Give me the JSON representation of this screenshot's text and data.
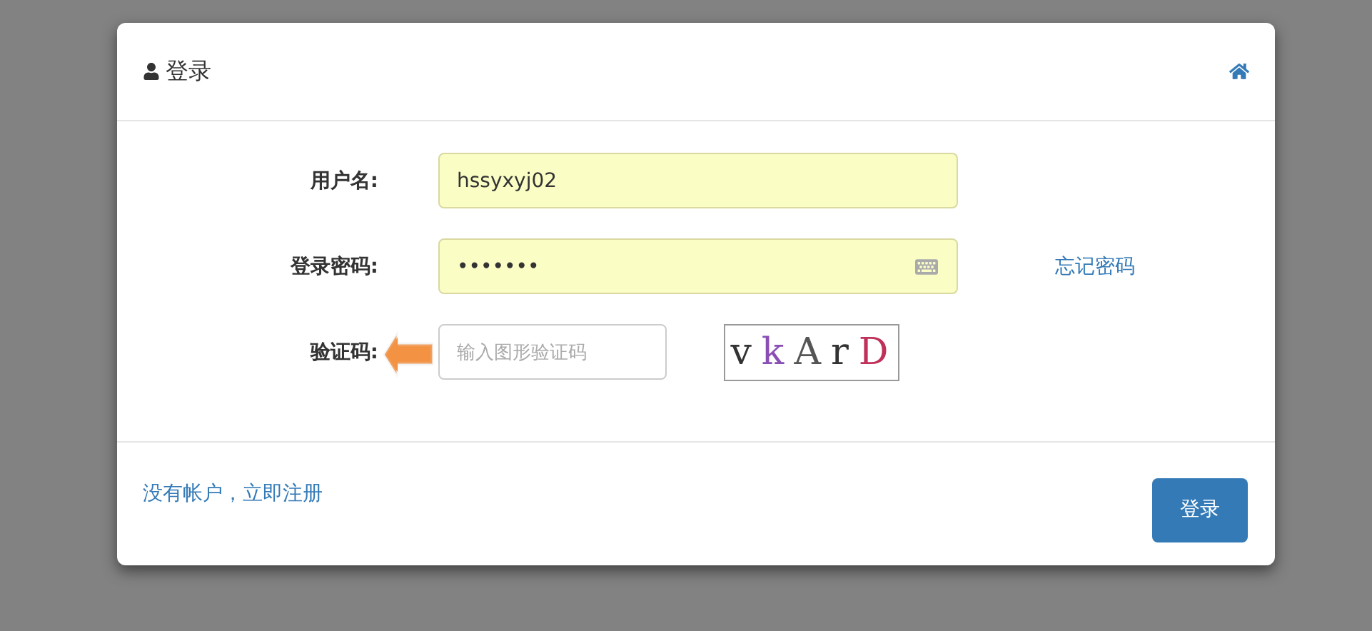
{
  "dialog": {
    "title": "登录"
  },
  "form": {
    "rows": [
      {
        "kind": "text",
        "label": "用户名:",
        "value": "hssyxyj02"
      },
      {
        "kind": "password",
        "label": "登录密码:",
        "value": "•••••••",
        "link": "忘记密码"
      },
      {
        "kind": "captcha",
        "label": "验证码:",
        "placeholder": "输入图形验证码",
        "captcha": "vkArD"
      }
    ]
  },
  "footer": {
    "link": "没有帐户，立即注册",
    "button": "登录"
  }
}
